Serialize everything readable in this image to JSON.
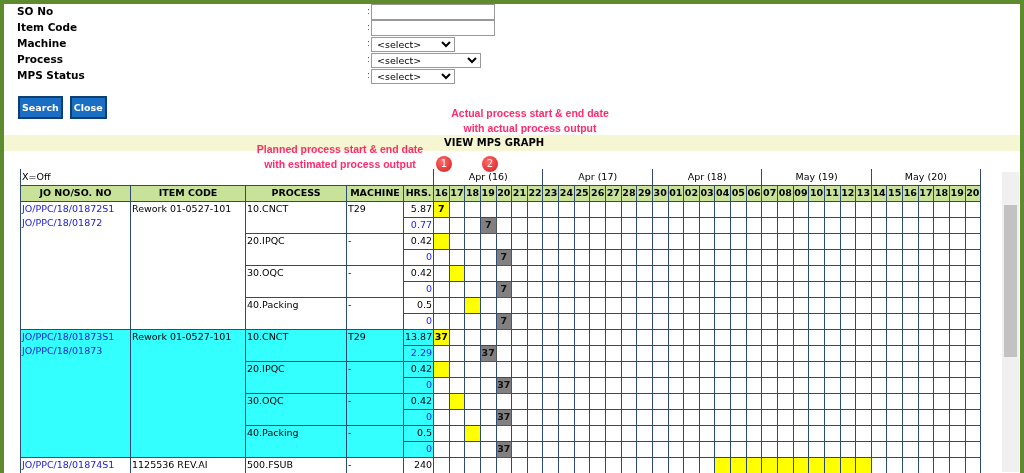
{
  "filters": [
    {
      "label": "SO No",
      "separator": ":",
      "kind": "text"
    },
    {
      "label": "Item Code",
      "separator": ":",
      "kind": "text"
    },
    {
      "label": "Machine",
      "separator": ":",
      "kind": "select",
      "value": "<select>"
    },
    {
      "label": "Process",
      "separator": ":",
      "kind": "select",
      "value": "<select>"
    },
    {
      "label": "MPS Status",
      "separator": ":",
      "kind": "select",
      "value": "<select>"
    }
  ],
  "buttons": [
    "Search",
    "Close"
  ],
  "graph_bar": {
    "title": "VIEW MPS GRAPH"
  },
  "annotations": [
    {
      "number": "1",
      "lines": [
        "Planned process start & end date",
        "with estimated process output"
      ]
    },
    {
      "number": "2",
      "lines": [
        "Actual process start & end date",
        "with actual process output"
      ]
    }
  ],
  "table": {
    "legend": "X=Off",
    "columns": [
      "JO NO/SO. NO",
      "ITEM CODE",
      "PROCESS",
      "MACHINE",
      "HRS."
    ],
    "weeks": [
      {
        "label": "Apr (16)",
        "days": [
          "16",
          "17",
          "18",
          "19",
          "20",
          "21",
          "22"
        ]
      },
      {
        "label": "Apr (17)",
        "days": [
          "23",
          "24",
          "25",
          "26",
          "27",
          "28",
          "29"
        ]
      },
      {
        "label": "Apr (18)",
        "days": [
          "30",
          "01",
          "02",
          "03",
          "04",
          "05",
          "06"
        ]
      },
      {
        "label": "May (19)",
        "days": [
          "07",
          "08",
          "09",
          "10",
          "11",
          "12",
          "13"
        ]
      },
      {
        "label": "May (20)",
        "days": [
          "14",
          "15",
          "16",
          "17",
          "18",
          "19",
          "20"
        ]
      }
    ],
    "groups": [
      {
        "jo_numbers": [
          "JO/PPC/18/01872S1",
          "JO/PPC/18/01872"
        ],
        "item_code": "Rework 01-0527-101",
        "highlighted": false,
        "processes": [
          {
            "process": "10.CNCT",
            "machine": "T29",
            "rows": [
              {
                "kind": "planned",
                "hours": "5.87",
                "bar_text": "7",
                "filled": [
                  true,
                  false,
                  false,
                  false,
                  false,
                  false,
                  false,
                  false,
                  false,
                  false,
                  false,
                  false,
                  false,
                  false,
                  false,
                  false,
                  false,
                  false,
                  false,
                  false,
                  false,
                  false,
                  false,
                  false,
                  false,
                  false,
                  false,
                  false,
                  false,
                  false,
                  false,
                  false,
                  false,
                  false,
                  false
                ]
              },
              {
                "kind": "actual",
                "hours": "0.77",
                "bar_text": "7",
                "filled": [
                  false,
                  false,
                  false,
                  true,
                  false,
                  false,
                  false,
                  false,
                  false,
                  false,
                  false,
                  false,
                  false,
                  false,
                  false,
                  false,
                  false,
                  false,
                  false,
                  false,
                  false,
                  false,
                  false,
                  false,
                  false,
                  false,
                  false,
                  false,
                  false,
                  false,
                  false,
                  false,
                  false,
                  false,
                  false
                ]
              }
            ]
          },
          {
            "process": "20.IPQC",
            "machine": "-",
            "rows": [
              {
                "kind": "planned",
                "hours": "0.42",
                "filled": [
                  true,
                  false,
                  false,
                  false,
                  false,
                  false,
                  false,
                  false,
                  false,
                  false,
                  false,
                  false,
                  false,
                  false,
                  false,
                  false,
                  false,
                  false,
                  false,
                  false,
                  false,
                  false,
                  false,
                  false,
                  false,
                  false,
                  false,
                  false,
                  false,
                  false,
                  false,
                  false,
                  false,
                  false,
                  false
                ]
              },
              {
                "kind": "actual",
                "hours": "0",
                "bar_text": "7",
                "filled": [
                  false,
                  false,
                  false,
                  false,
                  true,
                  false,
                  false,
                  false,
                  false,
                  false,
                  false,
                  false,
                  false,
                  false,
                  false,
                  false,
                  false,
                  false,
                  false,
                  false,
                  false,
                  false,
                  false,
                  false,
                  false,
                  false,
                  false,
                  false,
                  false,
                  false,
                  false,
                  false,
                  false,
                  false,
                  false
                ]
              }
            ]
          },
          {
            "process": "30.OQC",
            "machine": "-",
            "rows": [
              {
                "kind": "planned",
                "hours": "0.42",
                "filled": [
                  false,
                  true,
                  false,
                  false,
                  false,
                  false,
                  false,
                  false,
                  false,
                  false,
                  false,
                  false,
                  false,
                  false,
                  false,
                  false,
                  false,
                  false,
                  false,
                  false,
                  false,
                  false,
                  false,
                  false,
                  false,
                  false,
                  false,
                  false,
                  false,
                  false,
                  false,
                  false,
                  false,
                  false,
                  false
                ]
              },
              {
                "kind": "actual",
                "hours": "0",
                "bar_text": "7",
                "filled": [
                  false,
                  false,
                  false,
                  false,
                  true,
                  false,
                  false,
                  false,
                  false,
                  false,
                  false,
                  false,
                  false,
                  false,
                  false,
                  false,
                  false,
                  false,
                  false,
                  false,
                  false,
                  false,
                  false,
                  false,
                  false,
                  false,
                  false,
                  false,
                  false,
                  false,
                  false,
                  false,
                  false,
                  false,
                  false
                ]
              }
            ]
          },
          {
            "process": "40.Packing",
            "machine": "-",
            "rows": [
              {
                "kind": "planned",
                "hours": "0.5",
                "filled": [
                  false,
                  false,
                  true,
                  false,
                  false,
                  false,
                  false,
                  false,
                  false,
                  false,
                  false,
                  false,
                  false,
                  false,
                  false,
                  false,
                  false,
                  false,
                  false,
                  false,
                  false,
                  false,
                  false,
                  false,
                  false,
                  false,
                  false,
                  false,
                  false,
                  false,
                  false,
                  false,
                  false,
                  false,
                  false
                ]
              },
              {
                "kind": "actual",
                "hours": "0",
                "bar_text": "7",
                "filled": [
                  false,
                  false,
                  false,
                  false,
                  true,
                  false,
                  false,
                  false,
                  false,
                  false,
                  false,
                  false,
                  false,
                  false,
                  false,
                  false,
                  false,
                  false,
                  false,
                  false,
                  false,
                  false,
                  false,
                  false,
                  false,
                  false,
                  false,
                  false,
                  false,
                  false,
                  false,
                  false,
                  false,
                  false,
                  false
                ]
              }
            ]
          }
        ]
      },
      {
        "jo_numbers": [
          "JO/PPC/18/01873S1",
          "JO/PPC/18/01873"
        ],
        "item_code": "Rework 01-0527-101",
        "highlighted": true,
        "processes": [
          {
            "process": "10.CNCT",
            "machine": "T29",
            "rows": [
              {
                "kind": "planned",
                "hours": "13.87",
                "bar_text": "37",
                "filled": [
                  true,
                  false,
                  false,
                  false,
                  false,
                  false,
                  false,
                  false,
                  false,
                  false,
                  false,
                  false,
                  false,
                  false,
                  false,
                  false,
                  false,
                  false,
                  false,
                  false,
                  false,
                  false,
                  false,
                  false,
                  false,
                  false,
                  false,
                  false,
                  false,
                  false,
                  false,
                  false,
                  false,
                  false,
                  false
                ]
              },
              {
                "kind": "actual",
                "hours": "2.29",
                "bar_text": "37",
                "filled": [
                  false,
                  false,
                  false,
                  true,
                  false,
                  false,
                  false,
                  false,
                  false,
                  false,
                  false,
                  false,
                  false,
                  false,
                  false,
                  false,
                  false,
                  false,
                  false,
                  false,
                  false,
                  false,
                  false,
                  false,
                  false,
                  false,
                  false,
                  false,
                  false,
                  false,
                  false,
                  false,
                  false,
                  false,
                  false
                ]
              }
            ]
          },
          {
            "process": "20.IPQC",
            "machine": "-",
            "rows": [
              {
                "kind": "planned",
                "hours": "0.42",
                "filled": [
                  true,
                  false,
                  false,
                  false,
                  false,
                  false,
                  false,
                  false,
                  false,
                  false,
                  false,
                  false,
                  false,
                  false,
                  false,
                  false,
                  false,
                  false,
                  false,
                  false,
                  false,
                  false,
                  false,
                  false,
                  false,
                  false,
                  false,
                  false,
                  false,
                  false,
                  false,
                  false,
                  false,
                  false,
                  false
                ]
              },
              {
                "kind": "actual",
                "hours": "0",
                "bar_text": "37",
                "filled": [
                  false,
                  false,
                  false,
                  false,
                  true,
                  false,
                  false,
                  false,
                  false,
                  false,
                  false,
                  false,
                  false,
                  false,
                  false,
                  false,
                  false,
                  false,
                  false,
                  false,
                  false,
                  false,
                  false,
                  false,
                  false,
                  false,
                  false,
                  false,
                  false,
                  false,
                  false,
                  false,
                  false,
                  false,
                  false
                ]
              }
            ]
          },
          {
            "process": "30.OQC",
            "machine": "-",
            "rows": [
              {
                "kind": "planned",
                "hours": "0.42",
                "filled": [
                  false,
                  true,
                  false,
                  false,
                  false,
                  false,
                  false,
                  false,
                  false,
                  false,
                  false,
                  false,
                  false,
                  false,
                  false,
                  false,
                  false,
                  false,
                  false,
                  false,
                  false,
                  false,
                  false,
                  false,
                  false,
                  false,
                  false,
                  false,
                  false,
                  false,
                  false,
                  false,
                  false,
                  false,
                  false
                ]
              },
              {
                "kind": "actual",
                "hours": "0",
                "bar_text": "37",
                "filled": [
                  false,
                  false,
                  false,
                  false,
                  true,
                  false,
                  false,
                  false,
                  false,
                  false,
                  false,
                  false,
                  false,
                  false,
                  false,
                  false,
                  false,
                  false,
                  false,
                  false,
                  false,
                  false,
                  false,
                  false,
                  false,
                  false,
                  false,
                  false,
                  false,
                  false,
                  false,
                  false,
                  false,
                  false,
                  false
                ]
              }
            ]
          },
          {
            "process": "40.Packing",
            "machine": "-",
            "rows": [
              {
                "kind": "planned",
                "hours": "0.5",
                "filled": [
                  false,
                  false,
                  true,
                  false,
                  false,
                  false,
                  false,
                  false,
                  false,
                  false,
                  false,
                  false,
                  false,
                  false,
                  false,
                  false,
                  false,
                  false,
                  false,
                  false,
                  false,
                  false,
                  false,
                  false,
                  false,
                  false,
                  false,
                  false,
                  false,
                  false,
                  false,
                  false,
                  false,
                  false,
                  false
                ]
              },
              {
                "kind": "actual",
                "hours": "0",
                "bar_text": "37",
                "filled": [
                  false,
                  false,
                  false,
                  false,
                  true,
                  false,
                  false,
                  false,
                  false,
                  false,
                  false,
                  false,
                  false,
                  false,
                  false,
                  false,
                  false,
                  false,
                  false,
                  false,
                  false,
                  false,
                  false,
                  false,
                  false,
                  false,
                  false,
                  false,
                  false,
                  false,
                  false,
                  false,
                  false,
                  false,
                  false
                ]
              }
            ]
          }
        ]
      },
      {
        "jo_numbers": [
          "JO/PPC/18/01874S1"
        ],
        "item_code": "1125536 REV.AI",
        "highlighted": false,
        "processes": [
          {
            "process": "500.FSUB",
            "machine": "-",
            "rows": [
              {
                "kind": "planned",
                "hours": "240",
                "filled": [
                  false,
                  false,
                  false,
                  false,
                  false,
                  false,
                  false,
                  false,
                  false,
                  false,
                  false,
                  false,
                  false,
                  false,
                  false,
                  false,
                  false,
                  false,
                  true,
                  true,
                  true,
                  true,
                  true,
                  true,
                  true,
                  true,
                  true,
                  true,
                  false,
                  false,
                  false,
                  false,
                  false,
                  false,
                  false
                ]
              }
            ]
          }
        ]
      }
    ]
  }
}
